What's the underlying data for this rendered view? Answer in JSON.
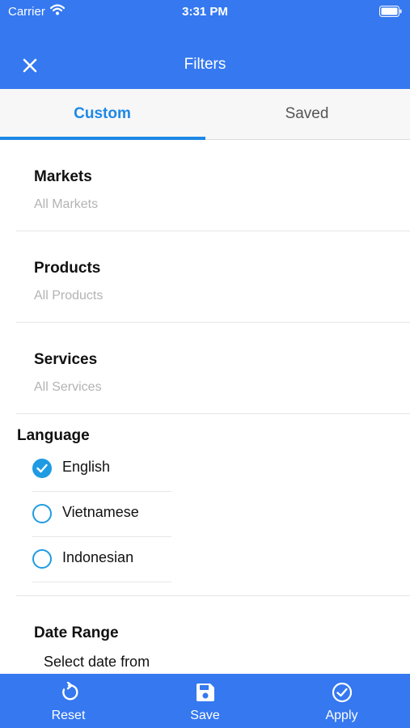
{
  "status_bar": {
    "carrier": "Carrier",
    "time": "3:31 PM"
  },
  "nav": {
    "title": "Filters"
  },
  "tabs": [
    {
      "label": "Custom",
      "active": true
    },
    {
      "label": "Saved",
      "active": false
    }
  ],
  "filters": {
    "markets": {
      "label": "Markets",
      "value": "All Markets"
    },
    "products": {
      "label": "Products",
      "value": "All Products"
    },
    "services": {
      "label": "Services",
      "value": "All Services"
    }
  },
  "language": {
    "label": "Language",
    "options": [
      {
        "label": "English",
        "selected": true
      },
      {
        "label": "Vietnamese",
        "selected": false
      },
      {
        "label": "Indonesian",
        "selected": false
      }
    ]
  },
  "date_range": {
    "label": "Date Range",
    "prompt": "Select date from"
  },
  "toolbar": {
    "reset_label": "Reset",
    "save_label": "Save",
    "apply_label": "Apply"
  },
  "colors": {
    "brand": "#3578f0",
    "accent": "#1e88e5",
    "radio": "#1e9be3"
  }
}
